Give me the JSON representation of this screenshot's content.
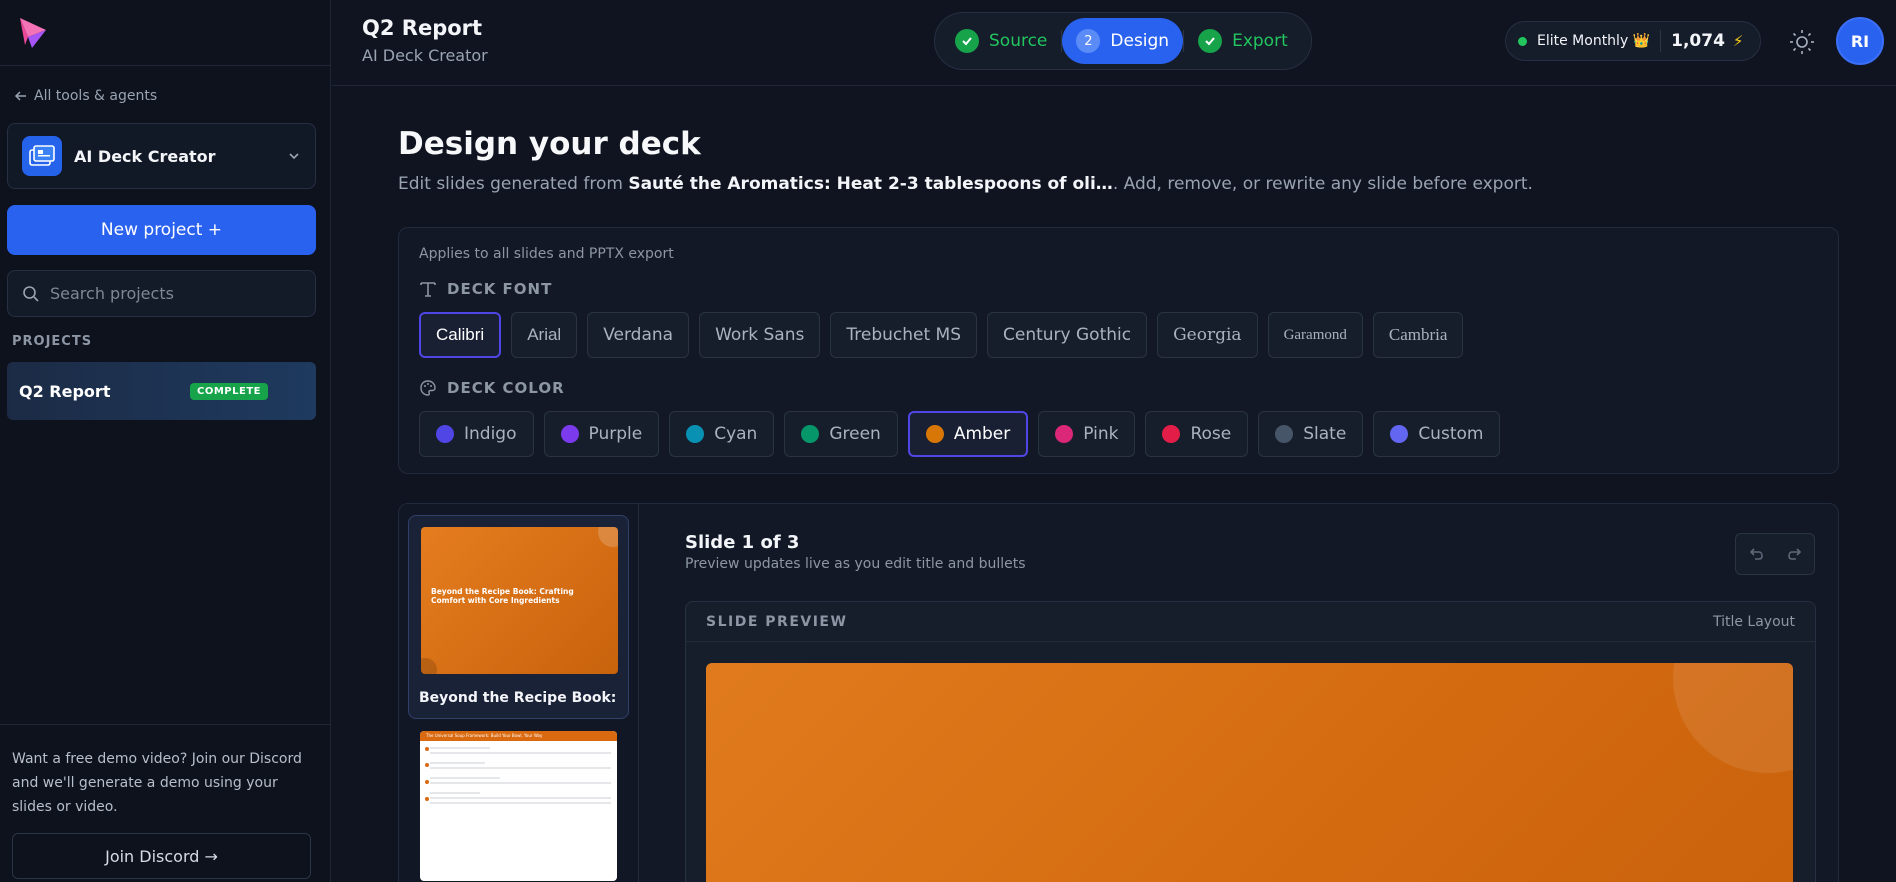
{
  "sidebar": {
    "back_label": "All tools & agents",
    "tool_name": "AI Deck Creator",
    "new_project_label": "New project +",
    "search_placeholder": "Search projects",
    "projects_heading": "PROJECTS",
    "projects": [
      {
        "name": "Q2 Report",
        "status": "COMPLETE"
      }
    ],
    "footer_text": "Want a free demo video? Join our Discord and we'll generate a demo using your slides or video.",
    "discord_label": "Join Discord →"
  },
  "header": {
    "title": "Q2 Report",
    "subtitle": "AI Deck Creator",
    "steps": [
      {
        "label": "Source",
        "state": "done"
      },
      {
        "label": "Design",
        "state": "active",
        "number": "2"
      },
      {
        "label": "Export",
        "state": "done"
      }
    ],
    "plan_name": "Elite Monthly 👑",
    "credits": "1,074",
    "bolt": "⚡",
    "avatar_initials": "RI"
  },
  "main": {
    "title": "Design your deck",
    "desc_prefix": "Edit slides generated from ",
    "desc_source": "Sauté the Aromatics: Heat 2-3 tablespoons of oli…",
    "desc_suffix": ". Add, remove, or rewrite any slide before export.",
    "applies_note": "Applies to all slides and PPTX export",
    "font_heading": "DECK FONT",
    "fonts": [
      "Calibri",
      "Arial",
      "Verdana",
      "Work Sans",
      "Trebuchet MS",
      "Century Gothic",
      "Georgia",
      "Garamond",
      "Cambria"
    ],
    "selected_font": "Calibri",
    "color_heading": "DECK COLOR",
    "colors": [
      {
        "name": "Indigo",
        "hex": "#4f46e5"
      },
      {
        "name": "Purple",
        "hex": "#7c3aed"
      },
      {
        "name": "Cyan",
        "hex": "#0891b2"
      },
      {
        "name": "Green",
        "hex": "#059669"
      },
      {
        "name": "Amber",
        "hex": "#d97706"
      },
      {
        "name": "Pink",
        "hex": "#db2777"
      },
      {
        "name": "Rose",
        "hex": "#e11d48"
      },
      {
        "name": "Slate",
        "hex": "#475569"
      },
      {
        "name": "Custom",
        "hex": "#6366f1"
      }
    ],
    "selected_color": "Amber"
  },
  "editor": {
    "thumb1_title": "Beyond the Recipe Book: Crafting Comfort with Core Ingredients",
    "thumb1_label": "Beyond the Recipe Book: …",
    "thumb2_title": "The Universal Soup Framework: Build Your Bowl, Your Way",
    "slide_counter": "Slide 1 of 3",
    "slide_hint": "Preview updates live as you edit title and bullets",
    "preview_label": "SLIDE PREVIEW",
    "layout_name": "Title Layout"
  }
}
